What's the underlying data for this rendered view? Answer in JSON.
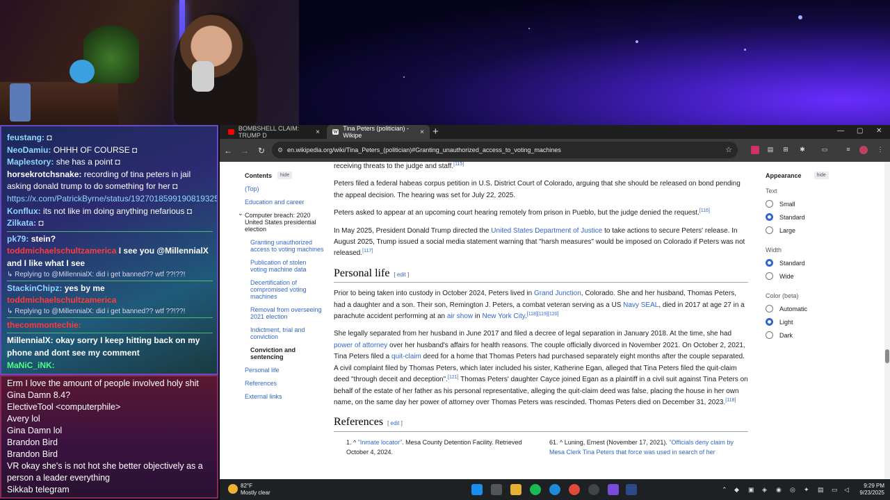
{
  "chat": [
    {
      "user": "feustang:",
      "user_color": "#8fd8ff",
      "text": "",
      "emote": true
    },
    {
      "user": "NeoDamiu:",
      "user_color": "#8fd8ff",
      "text": "OHHH OF COURSE",
      "emote": true
    },
    {
      "user": "Maplestory:",
      "user_color": "#8fd8ff",
      "text": "she has a point",
      "emote": true
    },
    {
      "user": "horsekrotchsnake:",
      "user_color": "#ffffff",
      "text": "recording of tina peters in jail asking donald trump to do something for her",
      "emote": true
    },
    {
      "user": "",
      "user_color": "#8fd8ff",
      "text": "https://x.com/PatrickByrne/status/1927018599190819325",
      "emote": false
    },
    {
      "user": "Konflux:",
      "user_color": "#8fd8ff",
      "text": "its not like im doing anything nefarious",
      "emote": true
    },
    {
      "user": "Zilkata:",
      "user_color": "#8fd8ff",
      "text": "",
      "emote": true
    }
  ],
  "chat_section": [
    {
      "user": "pk79:",
      "user_color": "#8fd8ff",
      "text": "stein?",
      "kind": "msg"
    },
    {
      "user": "toddmichaelschultzamerica",
      "user_color": "#ff3b3b",
      "text": "I see you @MillennialX and I like what I see",
      "kind": "msg"
    },
    {
      "user": "",
      "user_color": "#d8d8e8",
      "text": "Replying to @MillennialX: did i get banned?? wtf ??!??!",
      "kind": "reply"
    },
    {
      "user": "StackinChipz:",
      "user_color": "#8fd8ff",
      "text": "yes by me",
      "kind": "msg"
    },
    {
      "user": "toddmichaelschultzamerica",
      "user_color": "#ff3b3b",
      "text": "",
      "kind": "msg"
    },
    {
      "user": "",
      "user_color": "#d8d8e8",
      "text": "Replying to @MillennialX: did i get banned?? wtf ??!??!",
      "kind": "reply"
    },
    {
      "user": "thecommontechie:",
      "user_color": "#ff3b3b",
      "text": "",
      "kind": "msg"
    },
    {
      "user": "MillennialX:",
      "user_color": "#ffffff",
      "text": "okay sorry I keep hitting back on my phone and dont see my comment",
      "kind": "msg"
    },
    {
      "user": "MaNiC_iNK:",
      "user_color": "#4dff88",
      "text": "",
      "kind": "msg"
    }
  ],
  "chat2": [
    "Erm I love the amount of people involved holy shit",
    "Gina Damn 8.4?",
    "ElectiveTool <computerphile>",
    "Avery  lol",
    "Gina Damn lol",
    "Brandon Bird",
    "Brandon Bird",
    "VR okay she's is not hot she better objectively as a person a leader everything",
    "Sikkab        telegram"
  ],
  "browser": {
    "tabs": [
      {
        "label": "BOMBSHELL CLAIM: TRUMP D",
        "favicon": "youtube-icon"
      },
      {
        "label": "Tina Peters (politician) - Wikipe",
        "favicon": "wikipedia-icon"
      }
    ],
    "url": "en.wikipedia.org/wiki/Tina_Peters_(politician)#Granting_unauthorized_access_to_voting_machines"
  },
  "toc": {
    "title": "Contents",
    "hide": "hide",
    "items": [
      {
        "label": "(Top)",
        "level": 0
      },
      {
        "label": "Education and career",
        "level": 0
      },
      {
        "label": "Computer breach: 2020 United States presidential election",
        "level": 0,
        "expanded": true
      },
      {
        "label": "Granting unauthorized access to voting machines",
        "level": 1
      },
      {
        "label": "Publication of stolen voting machine data",
        "level": 1
      },
      {
        "label": "Decertification of compromised voting machines",
        "level": 1
      },
      {
        "label": "Removal from overseeing 2021 election",
        "level": 1
      },
      {
        "label": "Indictment, trial and conviction",
        "level": 1
      },
      {
        "label": "Conviction and sentencing",
        "level": 1,
        "current": true
      },
      {
        "label": "Personal life",
        "level": 0
      },
      {
        "label": "References",
        "level": 0
      },
      {
        "label": "External links",
        "level": 0
      }
    ]
  },
  "article": {
    "p0": "receiving threats to the judge and staff.",
    "p0_ref": "[115]",
    "p1": "Peters filed a federal habeas corpus petition in U.S. District Court of Colorado, arguing that she should be released on bond pending the appeal decision. The hearing was set for July 22, 2025.",
    "p2": "Peters asked to appear at an upcoming court hearing remotely from prison in Pueblo, but the judge denied the request.",
    "p2_ref": "[116]",
    "p3a": "In May 2025, President Donald Trump directed the ",
    "p3_link": "United States Department of Justice",
    "p3b": " to take actions to secure Peters' release. In August 2025, Trump issued a social media statement warning that \"harsh measures\" would be imposed on Colorado if Peters was not released.",
    "p3_ref": "[117]",
    "h_personal": "Personal life",
    "edit": "edit",
    "p4a": "Prior to being taken into custody in October 2024, Peters lived in ",
    "p4_link1": "Grand Junction",
    "p4b": ", Colorado. She and her husband, Thomas Peters, had a daughter and a son. Their son, Remington J. Peters, a combat veteran serving as a US ",
    "p4_link2": "Navy SEAL",
    "p4c": ", died in 2017 at age 27 in a parachute accident performing at an ",
    "p4_link3": "air show",
    "p4d": " in ",
    "p4_link4": "New York City",
    "p4d2": ".",
    "p4_ref": "[118][119][120]",
    "p5a": "She legally separated from her husband in June 2017 and filed a decree of legal separation in January 2018. At the time, she had ",
    "p5_link1": "power of attorney",
    "p5b": " over her husband's affairs for health reasons. The couple officially divorced in November 2021. On October 2, 2021, Tina Peters filed a ",
    "p5_link2": "quit-claim",
    "p5c": " deed for a home that Thomas Peters had purchased separately eight months after the couple separated. A civil complaint filed by Thomas Peters, which later included his sister, Katherine Egan, alleged that Tina Peters filed the quit-claim deed \"through deceit and deception\".",
    "p5_ref1": "[121]",
    "p5d": " Thomas Peters' daughter Cayce joined Egan as a plaintiff in a civil suit against Tina Peters on behalf of the estate of her father as his personal representative, alleging the quit-claim deed was false, placing the house in her own name, on the same day her power of attorney over Thomas Peters was rescinded. Thomas Peters died on December 31, 2023.",
    "p5_ref2": "[118]",
    "h_refs": "References",
    "ref60a": "1. ^ ",
    "ref60_link": "\"Inmate locator\"",
    "ref60b": ". Mesa County Detention Facility. Retrieved October 4, 2024.",
    "ref61a": "61. ^ Luning, Ernest (November 17, 2021). ",
    "ref61_link": "\"Officials deny claim by Mesa Clerk Tina Peters that force was used in search of her"
  },
  "appearance": {
    "title": "Appearance",
    "hide": "hide",
    "text_label": "Text",
    "text_opts": [
      "Small",
      "Standard",
      "Large"
    ],
    "text_selected": "Standard",
    "width_label": "Width",
    "width_opts": [
      "Standard",
      "Wide"
    ],
    "width_selected": "Standard",
    "color_label": "Color (beta)",
    "color_opts": [
      "Automatic",
      "Light",
      "Dark"
    ],
    "color_selected": "Light"
  },
  "taskbar": {
    "temp": "82°F",
    "weather": "Mostly clear",
    "time": "9:29 PM",
    "date": "9/23/2025"
  },
  "colors": {
    "link": "#3366cc",
    "tabbar": "#1f1f1f",
    "navbar": "#3c3c3c"
  }
}
